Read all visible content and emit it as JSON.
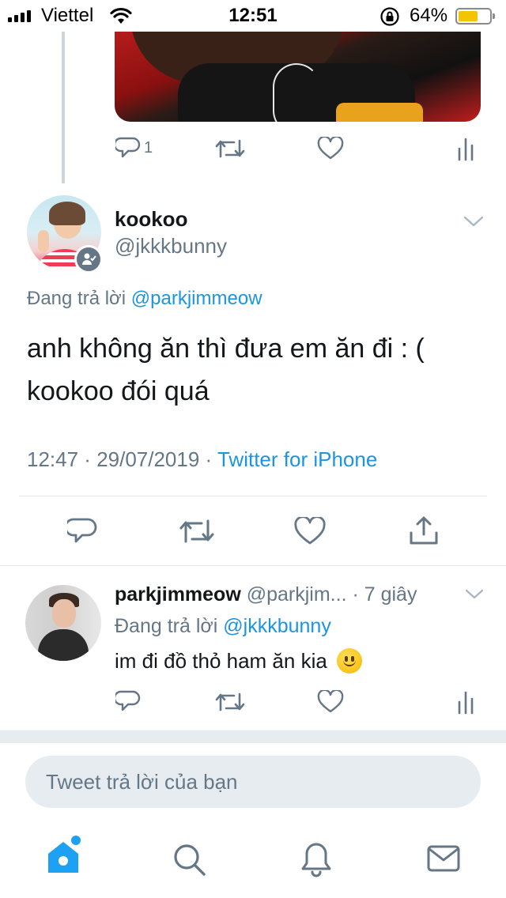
{
  "status_bar": {
    "carrier": "Viettel",
    "time": "12:51",
    "battery_percent": "64%",
    "battery_level": 0.64
  },
  "previous_tweet": {
    "reply_count": "1",
    "icons": [
      "reply-icon",
      "retweet-icon",
      "like-icon",
      "analytics-icon"
    ]
  },
  "main_tweet": {
    "name": "kookoo",
    "handle": "@jkkkbunny",
    "replying_prefix": "Đang trả lời ",
    "replying_to": "@parkjimmeow",
    "text": "anh không ăn thì đưa em ăn đi : ( kookoo đói quá",
    "time": "12:47",
    "date": "29/07/2019",
    "separator": " · ",
    "source": "Twitter for iPhone",
    "icons": [
      "reply-icon",
      "retweet-icon",
      "like-icon",
      "share-icon"
    ]
  },
  "reply_tweet": {
    "name": "parkjimmeow",
    "handle": "@parkjim...",
    "age": "7 giây",
    "separator": " · ",
    "replying_prefix": "Đang trả lời ",
    "replying_to": "@jkkkbunny",
    "text": "im đi đồ thỏ ham ăn kia",
    "emoji": "slightly-smiling-face",
    "icons": [
      "reply-icon",
      "retweet-icon",
      "like-icon",
      "analytics-icon"
    ]
  },
  "composer": {
    "placeholder": "Tweet trả lời của bạn"
  },
  "tab_bar": {
    "tabs": [
      "home-icon",
      "search-icon",
      "notifications-icon",
      "messages-icon"
    ],
    "active": "home-icon"
  },
  "colors": {
    "link": "#1b95e0",
    "accent": "#1da1f2",
    "secondary_text": "#657786",
    "divider": "#e1e8ed"
  }
}
